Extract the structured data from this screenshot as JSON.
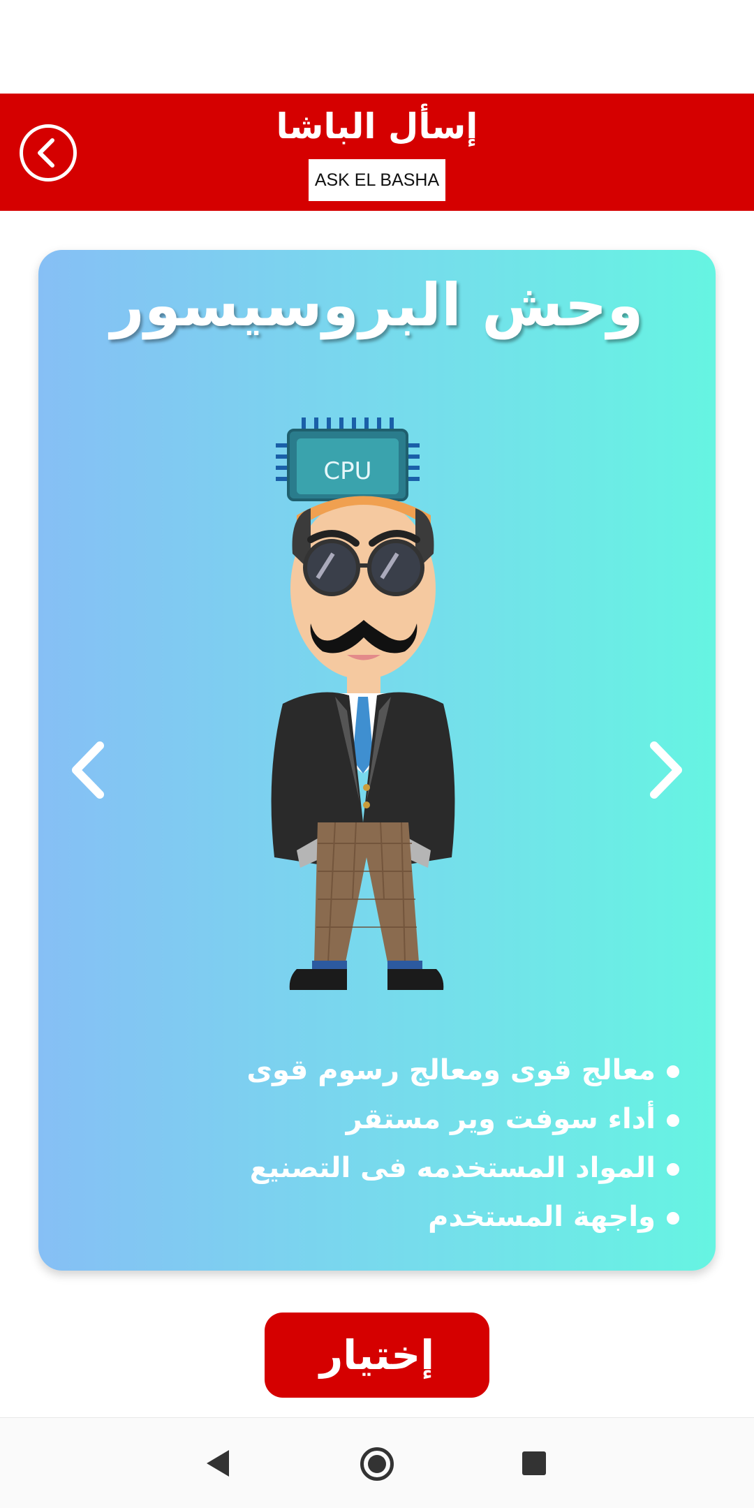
{
  "header": {
    "title": "إسأل الباشا",
    "subtitle": "ASK EL BASHA",
    "back_icon": "chevron-left-circle-icon",
    "color": "#d50000"
  },
  "card": {
    "title": "وحش البروسيسور",
    "chip_label": "CPU",
    "prev_icon": "chevron-left-icon",
    "next_icon": "chevron-right-icon",
    "features": [
      "معالج قوى ومعالج رسوم قوى",
      "أداء سوفت وير مستقر",
      "المواد المستخدمه فى التصنيع",
      "واجهة المستخدم"
    ]
  },
  "actions": {
    "choose_label": "إختيار"
  },
  "navigation": {
    "back_icon": "nav-back-icon",
    "home_icon": "nav-home-icon",
    "recent_icon": "nav-recent-apps-icon"
  }
}
